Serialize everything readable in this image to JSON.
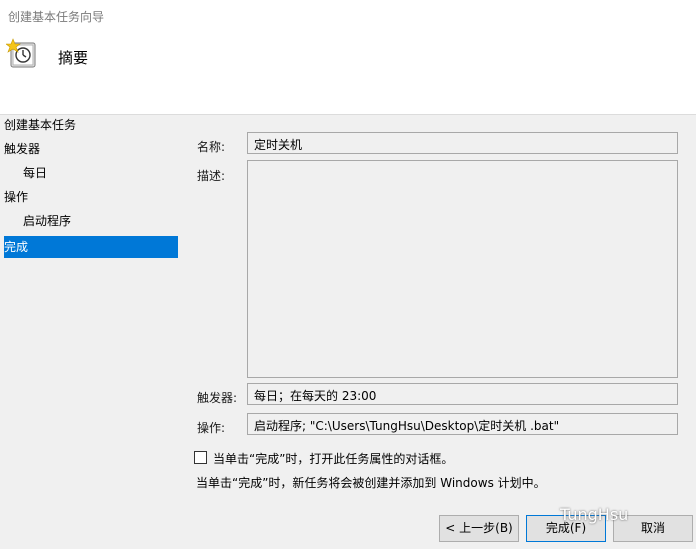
{
  "window": {
    "title": "创建基本任务向导"
  },
  "header": {
    "heading": "摘要",
    "icon": "task-clock-icon"
  },
  "nav": {
    "items": [
      {
        "label": "创建基本任务",
        "level": 0,
        "active": false
      },
      {
        "label": "触发器",
        "level": 0,
        "active": false
      },
      {
        "label": "每日",
        "level": 1,
        "active": false
      },
      {
        "label": "操作",
        "level": 0,
        "active": false
      },
      {
        "label": "启动程序",
        "level": 1,
        "active": false
      },
      {
        "label": "完成",
        "level": 0,
        "active": true
      }
    ]
  },
  "form": {
    "name_label": "名称:",
    "name_value": "定时关机",
    "desc_label": "描述:",
    "desc_value": "",
    "trigger_label": "触发器:",
    "trigger_value": "每日；在每天的 23:00",
    "action_label": "操作:",
    "action_value": "启动程序; \"C:\\Users\\TungHsu\\Desktop\\定时关机 .bat\""
  },
  "options": {
    "open_props_checkbox_label": "当单击“完成”时，打开此任务属性的对话框。",
    "open_props_checked": false,
    "note": "当单击“完成”时，新任务将会被创建并添加到 Windows 计划中。"
  },
  "buttons": {
    "back": "< 上一步(B)",
    "finish": "完成(F)",
    "cancel": "取消"
  },
  "watermark": "TungHsu"
}
